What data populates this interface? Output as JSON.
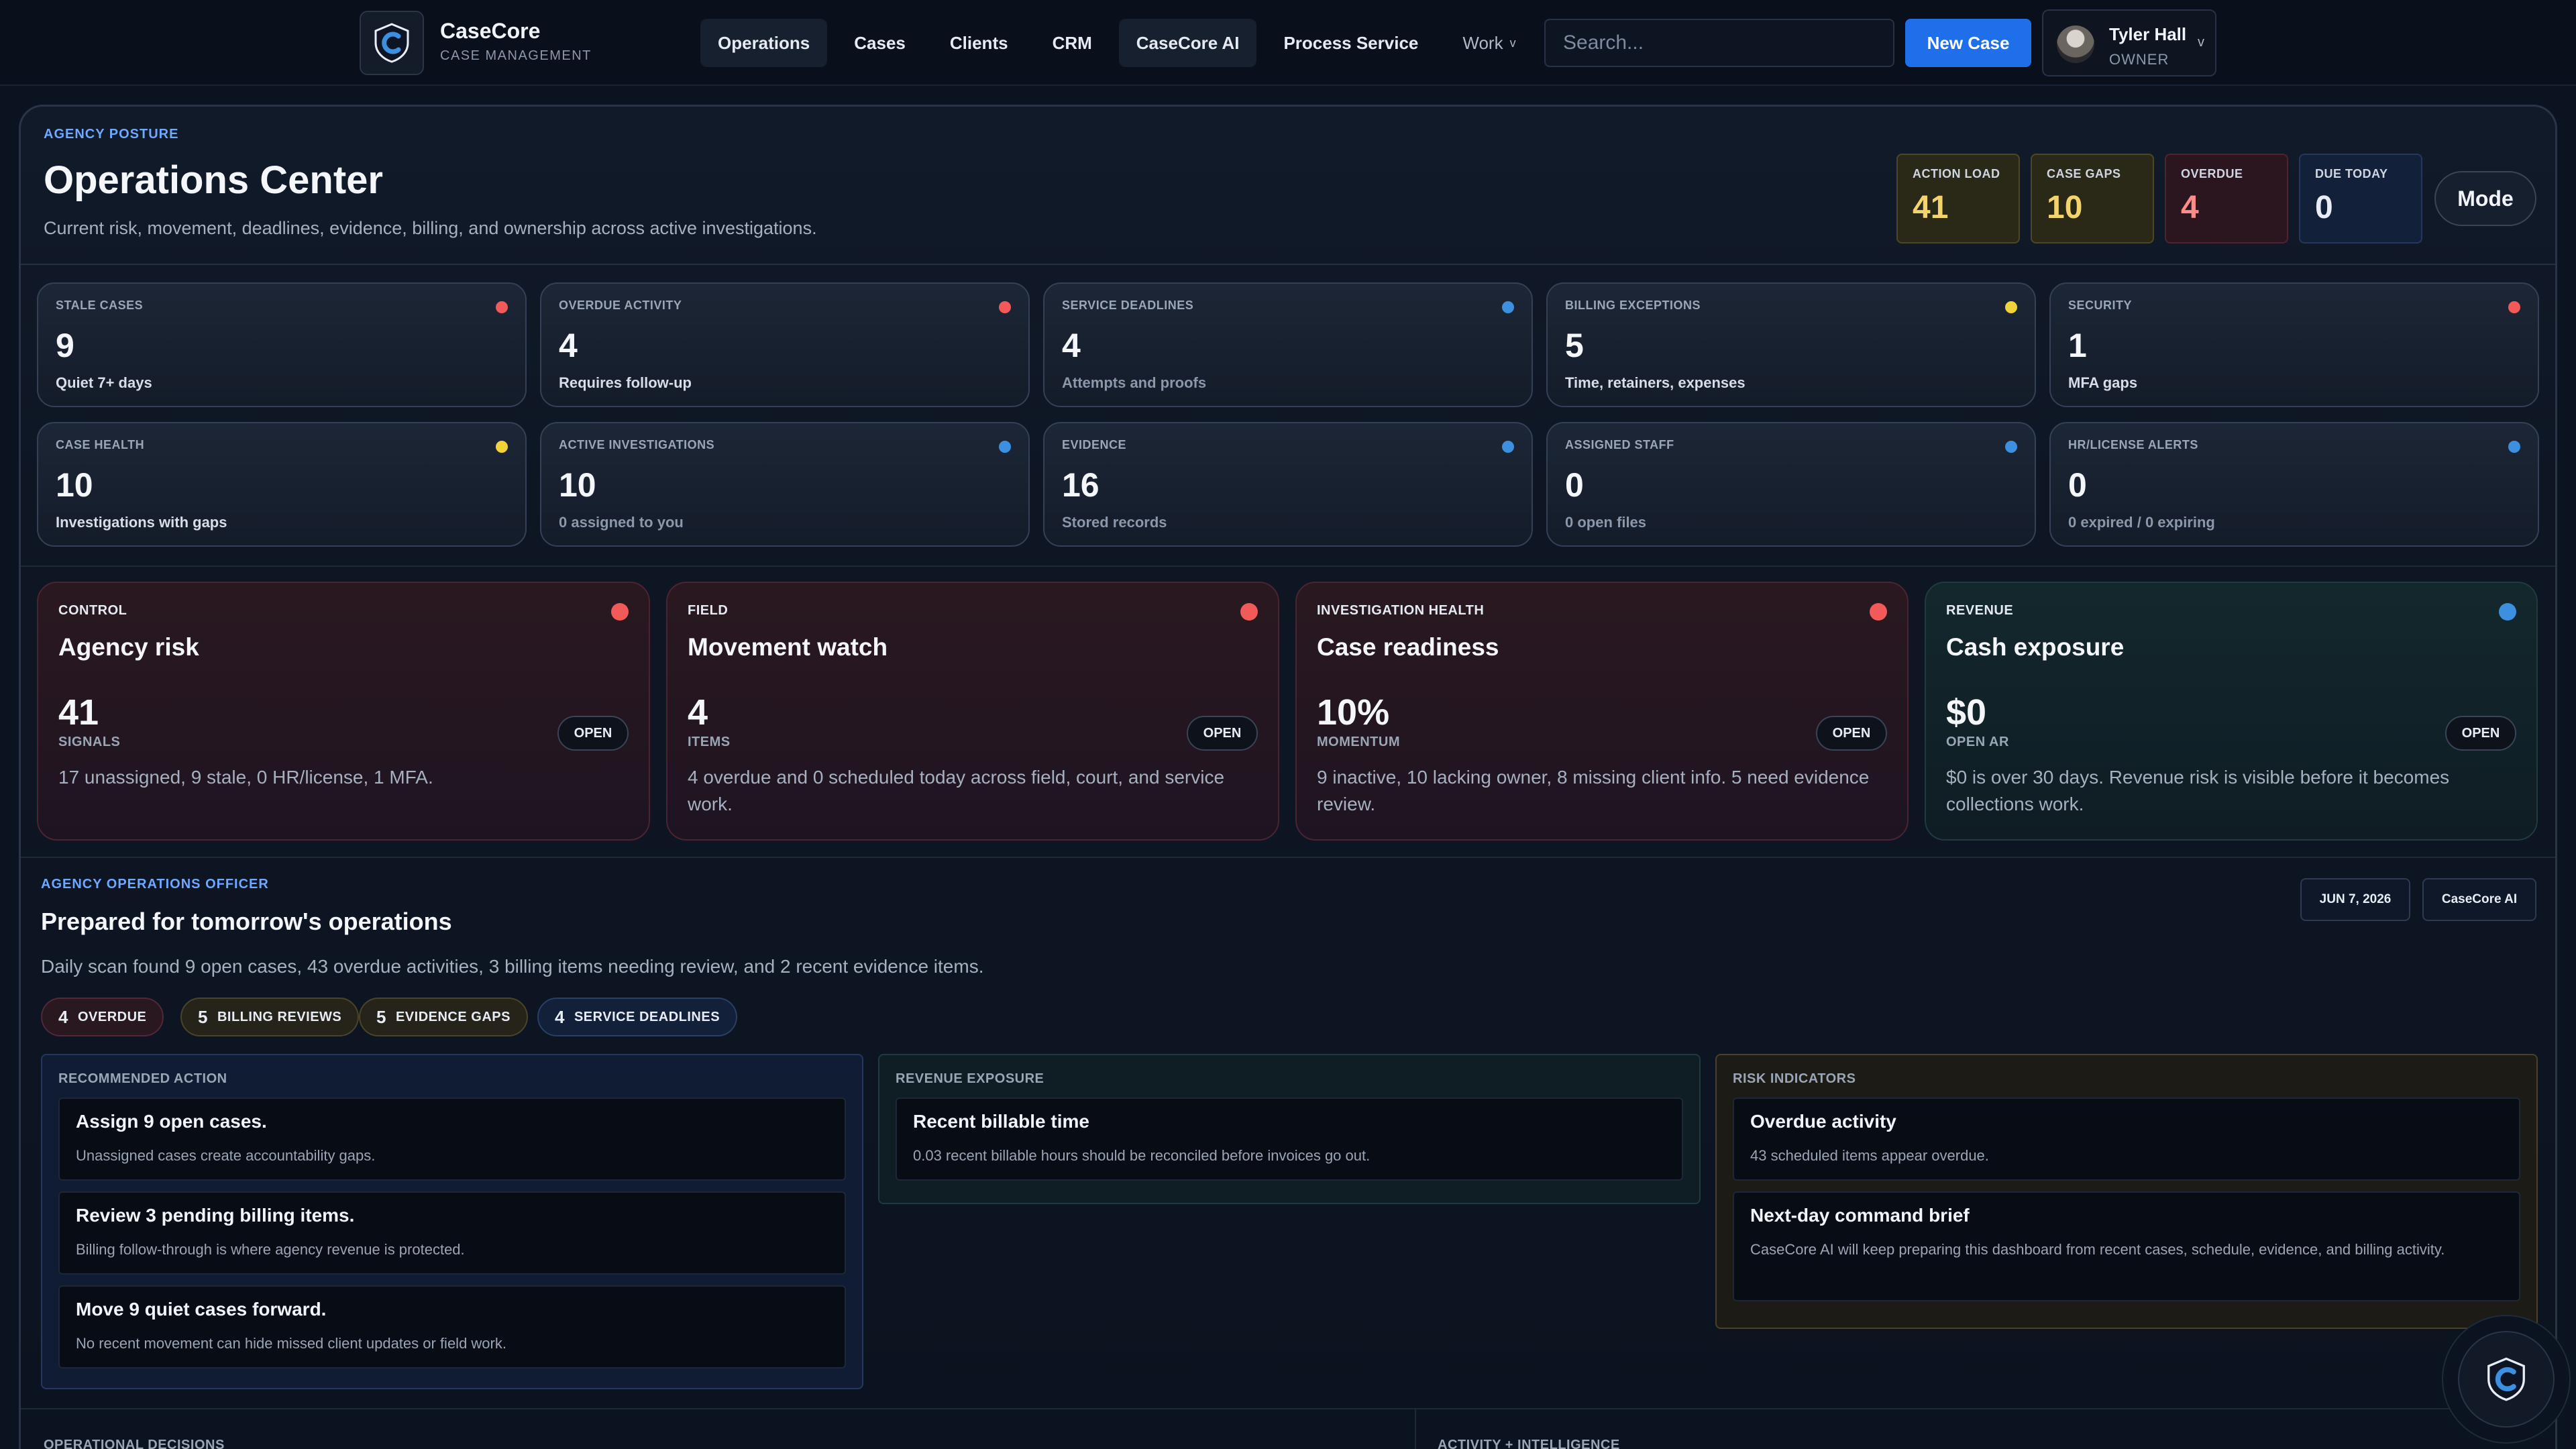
{
  "brand": {
    "name": "CaseCore",
    "subtitle": "CASE MANAGEMENT",
    "logo_icon": "shield-c-icon"
  },
  "nav": {
    "items": [
      {
        "label": "Operations",
        "active": true
      },
      {
        "label": "Cases"
      },
      {
        "label": "Clients"
      },
      {
        "label": "CRM"
      },
      {
        "label": "CaseCore AI",
        "highlight": true
      },
      {
        "label": "Process Service"
      },
      {
        "label": "Work",
        "dropdown": true,
        "chevron": "v"
      }
    ]
  },
  "search": {
    "placeholder": "Search..."
  },
  "new_case_label": "New Case",
  "user": {
    "name": "Tyler Hall",
    "role": "OWNER",
    "chevron": "v"
  },
  "posture": {
    "kicker": "AGENCY POSTURE",
    "title": "Operations Center",
    "subtitle": "Current risk, movement, deadlines, evidence, billing, and ownership across active investigations.",
    "stats": [
      {
        "label": "ACTION LOAD",
        "value": "41"
      },
      {
        "label": "CASE GAPS",
        "value": "10"
      },
      {
        "label": "OVERDUE",
        "value": "4"
      },
      {
        "label": "DUE TODAY",
        "value": "0"
      }
    ],
    "mode_label": "Mode"
  },
  "metrics": [
    {
      "label": "STALE CASES",
      "value": "9",
      "note": "Quiet 7+ days",
      "status": "red"
    },
    {
      "label": "OVERDUE ACTIVITY",
      "value": "4",
      "note": "Requires follow-up",
      "status": "red"
    },
    {
      "label": "SERVICE DEADLINES",
      "value": "4",
      "note": "Attempts and proofs",
      "status": "blue"
    },
    {
      "label": "BILLING EXCEPTIONS",
      "value": "5",
      "note": "Time, retainers, expenses",
      "status": "yellow"
    },
    {
      "label": "SECURITY",
      "value": "1",
      "note": "MFA gaps",
      "status": "red"
    },
    {
      "label": "CASE HEALTH",
      "value": "10",
      "note": "Investigations with gaps",
      "status": "yellow"
    },
    {
      "label": "ACTIVE INVESTIGATIONS",
      "value": "10",
      "note": "0 assigned to you",
      "status": "blue"
    },
    {
      "label": "EVIDENCE",
      "value": "16",
      "note": "Stored records",
      "status": "blue"
    },
    {
      "label": "ASSIGNED STAFF",
      "value": "0",
      "note": "0 open files",
      "status": "blue"
    },
    {
      "label": "HR/LICENSE ALERTS",
      "value": "0",
      "note": "0 expired / 0 expiring",
      "status": "blue"
    }
  ],
  "summaries": [
    {
      "tag": "CONTROL",
      "title": "Agency risk",
      "value": "41",
      "unit": "SIGNALS",
      "desc": "17 unassigned, 9 stale, 0 HR/license, 1 MFA.",
      "action": "OPEN",
      "status": "red"
    },
    {
      "tag": "FIELD",
      "title": "Movement watch",
      "value": "4",
      "unit": "ITEMS",
      "desc": "4 overdue and 0 scheduled today across field, court, and service work.",
      "action": "OPEN",
      "status": "red"
    },
    {
      "tag": "INVESTIGATION HEALTH",
      "title": "Case readiness",
      "value": "10%",
      "unit": "MOMENTUM",
      "desc": "9 inactive, 10 lacking owner, 8 missing client info. 5 need evidence review.",
      "action": "OPEN",
      "status": "red"
    },
    {
      "tag": "REVENUE",
      "title": "Cash exposure",
      "value": "$0",
      "unit": "OPEN AR",
      "desc": "$0 is over 30 days. Revenue risk is visible before it becomes collections work.",
      "action": "OPEN",
      "status": "blue"
    }
  ],
  "officer": {
    "kicker": "AGENCY OPERATIONS OFFICER",
    "title": "Prepared for tomorrow's operations",
    "subtitle": "Daily scan found 9 open cases, 43 overdue activities, 3 billing items needing review, and 2 recent evidence items.",
    "date": "JUN 7, 2026",
    "ai_label": "CaseCore AI",
    "pills": [
      {
        "count": "4",
        "label": "OVERDUE"
      },
      {
        "count": "5",
        "label": "BILLING REVIEWS"
      },
      {
        "count": "5",
        "label": "EVIDENCE GAPS"
      },
      {
        "count": "4",
        "label": "SERVICE DEADLINES"
      }
    ],
    "recommended": {
      "header": "RECOMMENDED ACTION",
      "items": [
        {
          "title": "Assign 9 open cases.",
          "desc": "Unassigned cases create accountability gaps."
        },
        {
          "title": "Review 3 pending billing items.",
          "desc": "Billing follow-through is where agency revenue is protected."
        },
        {
          "title": "Move 9 quiet cases forward.",
          "desc": "No recent movement can hide missed client updates or field work."
        }
      ]
    },
    "revenue": {
      "header": "REVENUE EXPOSURE",
      "items": [
        {
          "title": "Recent billable time",
          "desc": "0.03 recent billable hours should be reconciled before invoices go out."
        }
      ]
    },
    "risk": {
      "header": "RISK INDICATORS",
      "items": [
        {
          "title": "Overdue activity",
          "desc": "43 scheduled items appear overdue."
        },
        {
          "title": "Next-day command brief",
          "desc": "CaseCore AI will keep preparing this dashboard from recent cases, schedule, evidence, and billing activity."
        }
      ]
    }
  },
  "bottom": {
    "left_header": "OPERATIONAL DECISIONS",
    "right_header": "ACTIVITY + INTELLIGENCE"
  },
  "colors": {
    "accent": "#1f6feb",
    "red": "#f25a5a",
    "blue": "#3d8fe0",
    "yellow": "#f2d23a",
    "background": "#0b1220"
  }
}
